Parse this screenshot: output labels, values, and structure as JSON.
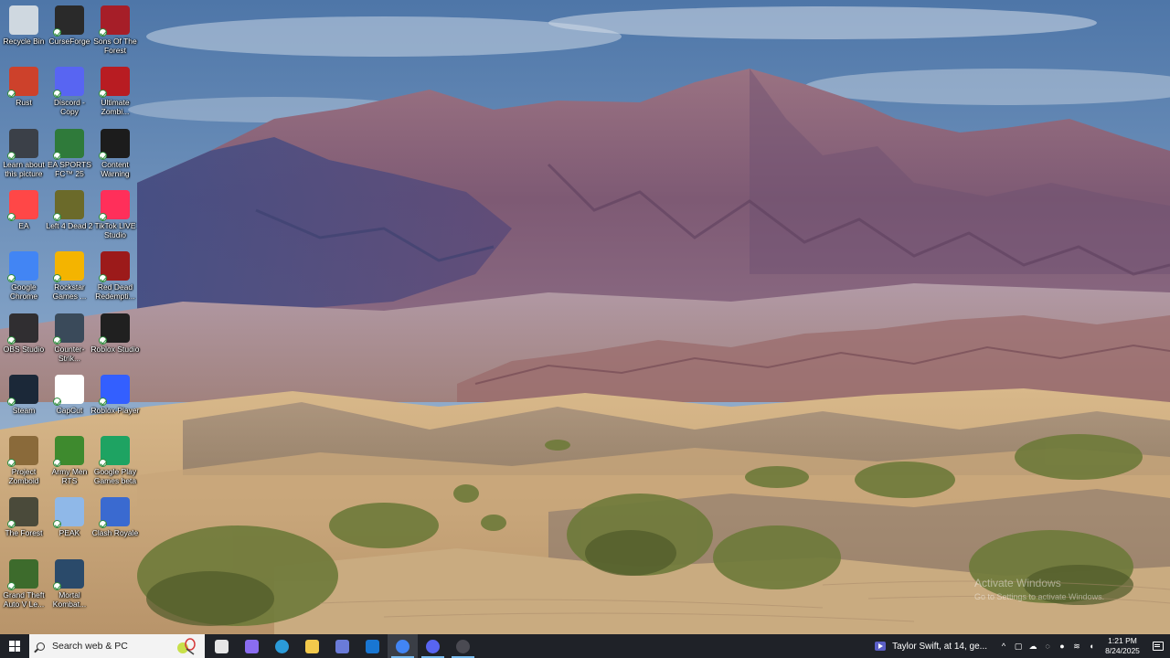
{
  "desktop_icons": [
    {
      "label": "Recycle Bin",
      "icon": "recycle-bin-icon",
      "color": "#cfd8e0"
    },
    {
      "label": "CurseForge",
      "icon": "curseforge-icon",
      "color": "#2a2a2a"
    },
    {
      "label": "Sons Of The Forest",
      "icon": "sons-of-the-forest-icon",
      "color": "#a61e28"
    },
    {
      "label": "Rust",
      "icon": "rust-icon",
      "color": "#cd412b"
    },
    {
      "label": "Discord - Copy",
      "icon": "discord-icon",
      "color": "#5865f2"
    },
    {
      "label": "Ultimate Zombi...",
      "icon": "ultimate-zombie-icon",
      "color": "#b81c22"
    },
    {
      "label": "Learn about this picture",
      "icon": "learn-about-picture-icon",
      "color": "#3b4048"
    },
    {
      "label": "EA SPORTS FC™ 25",
      "icon": "ea-sports-fc-icon",
      "color": "#2f7a3a"
    },
    {
      "label": "Content Warning",
      "icon": "content-warning-icon",
      "color": "#1c1c1c"
    },
    {
      "label": "EA",
      "icon": "ea-icon",
      "color": "#ff4747"
    },
    {
      "label": "Left 4 Dead 2",
      "icon": "left-4-dead-icon",
      "color": "#6b6a2a"
    },
    {
      "label": "TikTok LIVE Studio",
      "icon": "tiktok-live-studio-icon",
      "color": "#ff2f5a"
    },
    {
      "label": "Google Chrome",
      "icon": "chrome-icon",
      "color": "#4285f4"
    },
    {
      "label": "Rockstar Games ...",
      "icon": "rockstar-games-icon",
      "color": "#f4b400"
    },
    {
      "label": "Red Dead Redempti...",
      "icon": "red-dead-redemption-icon",
      "color": "#9c1a1a"
    },
    {
      "label": "OBS Studio",
      "icon": "obs-studio-icon",
      "color": "#302e31"
    },
    {
      "label": "Counter-Strik...",
      "icon": "counter-strike-icon",
      "color": "#3a4a5a"
    },
    {
      "label": "Roblox Studio",
      "icon": "roblox-studio-icon",
      "color": "#202020"
    },
    {
      "label": "Steam",
      "icon": "steam-icon",
      "color": "#1b2838"
    },
    {
      "label": "CapCut",
      "icon": "capcut-icon",
      "color": "#ffffff"
    },
    {
      "label": "Roblox Player",
      "icon": "roblox-player-icon",
      "color": "#335fff"
    },
    {
      "label": "Project Zomboid",
      "icon": "project-zomboid-icon",
      "color": "#8a6a3a"
    },
    {
      "label": "Army Men RTS",
      "icon": "army-men-rts-icon",
      "color": "#3e8a2e"
    },
    {
      "label": "Google Play Games beta",
      "icon": "google-play-games-icon",
      "color": "#1ea362"
    },
    {
      "label": "The Forest",
      "icon": "the-forest-icon",
      "color": "#4a4a3a"
    },
    {
      "label": "PEAK",
      "icon": "peak-icon",
      "color": "#8fb8e8"
    },
    {
      "label": "Clash Royale",
      "icon": "clash-royale-icon",
      "color": "#3a6ad0"
    },
    {
      "label": "Grand Theft Auto V Le...",
      "icon": "gta-v-icon",
      "color": "#3d6b2c"
    },
    {
      "label": "Mortal Kombat...",
      "icon": "mortal-kombat-icon",
      "color": "#2a4a6a"
    }
  ],
  "taskbar": {
    "search_placeholder": "Search web & PC",
    "apps": [
      {
        "name": "task-view-icon",
        "open": false,
        "active": false
      },
      {
        "name": "copilot-icon",
        "open": false,
        "active": false
      },
      {
        "name": "edge-icon",
        "open": false,
        "active": false
      },
      {
        "name": "file-explorer-icon",
        "open": false,
        "active": false
      },
      {
        "name": "microsoft-store-icon",
        "open": false,
        "active": false
      },
      {
        "name": "outlook-icon",
        "open": false,
        "active": false
      },
      {
        "name": "chrome-icon",
        "open": true,
        "active": true
      },
      {
        "name": "discord-icon",
        "open": true,
        "active": false
      },
      {
        "name": "obs-studio-icon",
        "open": true,
        "active": false
      }
    ],
    "news_text": "Taylor Swift, at 14, ge...",
    "clock_time": "1:21 PM",
    "clock_date": "8/24/2025"
  },
  "watermark": {
    "title": "Activate Windows",
    "subtitle": "Go to Settings to activate Windows."
  },
  "colors": {
    "taskbar_bg": "#1f2228",
    "accent": "#76b9ed"
  }
}
